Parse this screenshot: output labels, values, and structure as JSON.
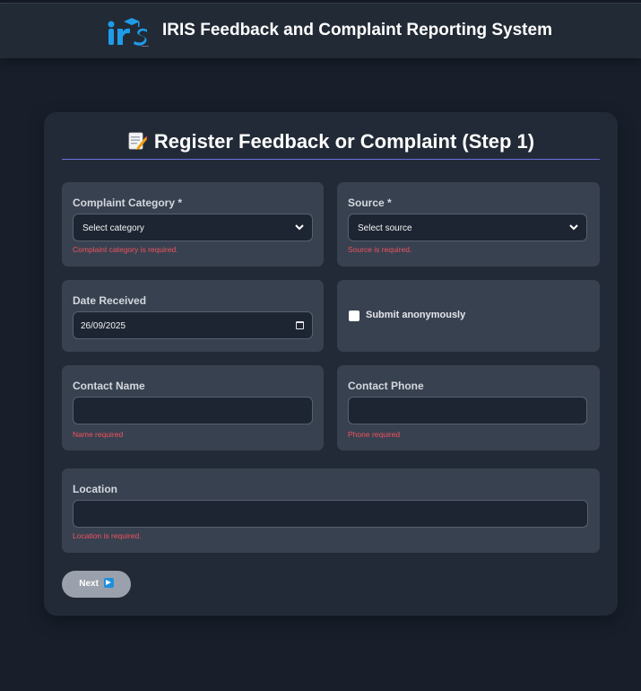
{
  "header": {
    "title": "IRIS Feedback and Complaint Reporting System",
    "logo_text": "IRIS"
  },
  "form": {
    "title": "Register Feedback or Complaint (Step 1)",
    "title_icon": "memo-icon",
    "category": {
      "label": "Complaint Category *",
      "value": "Select category",
      "error": "Complaint category is required."
    },
    "source": {
      "label": "Source *",
      "value": "Select source",
      "error": "Source is required."
    },
    "date": {
      "label": "Date Received",
      "value": "26/09/2025"
    },
    "anonymous": {
      "label": "Submit anonymously",
      "checked": false
    },
    "contact_name": {
      "label": "Contact Name",
      "value": "",
      "error": "Name required"
    },
    "contact_phone": {
      "label": "Contact Phone",
      "value": "",
      "error": "Phone required"
    },
    "location": {
      "label": "Location",
      "value": "",
      "error": "Location is required."
    },
    "next_label": "Next"
  },
  "colors": {
    "background": "#181f2b",
    "card": "#222a37",
    "panel": "#384150",
    "error": "#f0525e",
    "accent_line": "#6b6fe0",
    "button": "#9aa1ac"
  }
}
